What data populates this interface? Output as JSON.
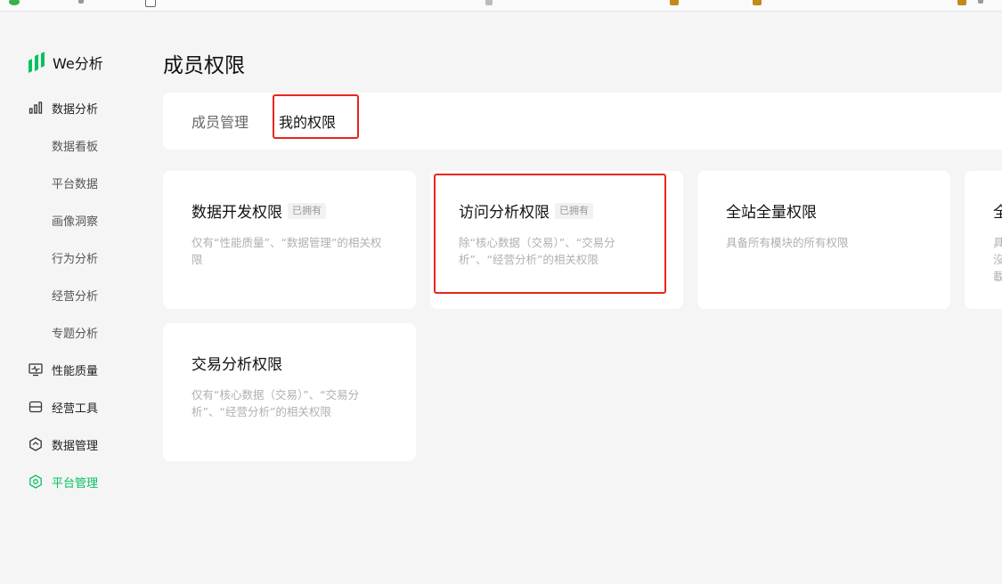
{
  "brand": {
    "name": "We分析",
    "accent": "#07c160"
  },
  "sidebar": {
    "items": [
      {
        "label": "数据分析",
        "icon": "bar-chart-icon"
      },
      {
        "label": "数据看板"
      },
      {
        "label": "平台数据"
      },
      {
        "label": "画像洞察"
      },
      {
        "label": "行为分析"
      },
      {
        "label": "经营分析"
      },
      {
        "label": "专题分析"
      },
      {
        "label": "性能质量",
        "icon": "monitor-icon"
      },
      {
        "label": "经营工具",
        "icon": "toolbox-icon"
      },
      {
        "label": "数据管理",
        "icon": "hexagon-check-icon"
      },
      {
        "label": "平台管理",
        "icon": "hexagon-settings-icon",
        "active": true
      }
    ]
  },
  "page": {
    "title": "成员权限"
  },
  "tabs": [
    {
      "label": "成员管理"
    },
    {
      "label": "我的权限",
      "active": true
    }
  ],
  "cards": [
    {
      "title": "数据开发权限",
      "badge": "已拥有",
      "desc": "仅有“性能质量”、“数据管理”的相关权限"
    },
    {
      "title": "访问分析权限",
      "badge": "已拥有",
      "desc": "除“核心数据（交易）”、“交易分析”、“经营分析”的相关权限"
    },
    {
      "title": "全站全量权限",
      "badge": "",
      "desc": "具备所有模块的所有权限"
    },
    {
      "title": "全",
      "badge": "",
      "desc": "具沒載"
    },
    {
      "title": "交易分析权限",
      "badge": "",
      "desc": "仅有“核心数据（交易）”、“交易分析”、“经营分析”的相关权限"
    }
  ],
  "colors": {
    "highlight": "#e8261c",
    "background": "#f5f5f5"
  }
}
